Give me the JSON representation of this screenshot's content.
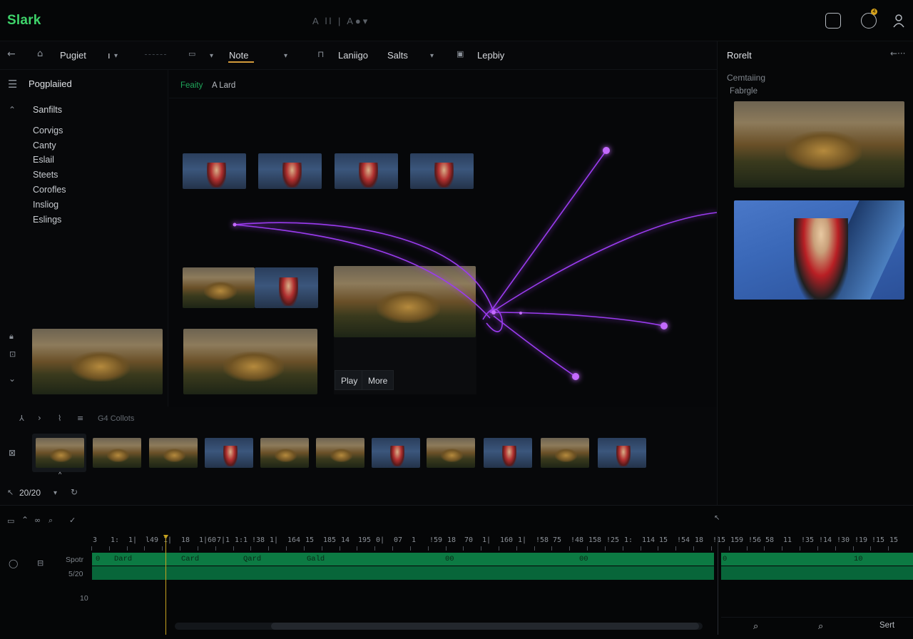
{
  "app": {
    "logo": "Slark",
    "center_title": "A ll | A●▾"
  },
  "topbar": {
    "icons": [
      "bag-icon",
      "notification-icon",
      "profile-icon"
    ],
    "badge": "4"
  },
  "toolbar": {
    "items": [
      {
        "label": "Pugiet"
      },
      {
        "label": "ı"
      },
      {
        "label": "Note"
      },
      {
        "label": "Laniigo"
      },
      {
        "label": "Salts"
      },
      {
        "label": "Lepbiy"
      }
    ]
  },
  "sidebar": {
    "title": "Pogplaiied",
    "section": "Sanfilts",
    "items": [
      "Corvigs",
      "Canty",
      "Eslail",
      "Steets",
      "Corofles",
      "Insliog",
      "Eslings"
    ]
  },
  "canvas": {
    "filters": [
      "Feaity",
      "A Lard"
    ],
    "buttons": {
      "play": "Play",
      "more": "More"
    }
  },
  "filmstrip": {
    "label": "G4 Collots",
    "counter": "20/20"
  },
  "right_panel": {
    "title": "Rorelt",
    "subtitle": "Cemtaiing",
    "label": "Fabrgle"
  },
  "timeline": {
    "ruler": [
      "3",
      "1:",
      "1|",
      "l49",
      "1|",
      "18",
      "1|60",
      "7|1",
      "1:1",
      "!38",
      "1|",
      "164",
      "15",
      "185",
      "14",
      "195",
      "0|",
      "07",
      "1",
      "!59",
      "18",
      "70",
      "1|",
      "160",
      "1|",
      "!58",
      "75",
      "!48",
      "158",
      "!25",
      "1:",
      "114",
      "15",
      "!54",
      "18",
      "!15",
      "159",
      "!56",
      "58",
      "11",
      "!35",
      "!14",
      "!30",
      "!19",
      "!15",
      "15"
    ],
    "track_labels": {
      "side_top": "Spotr",
      "side_mid": "5/20",
      "side_bot": "10"
    },
    "clips": [
      "0",
      "Dard",
      "Card",
      "Qard",
      "Gald",
      "00",
      "00",
      "0",
      "10"
    ],
    "bottom_buttons": {
      "search": "⌕",
      "search2": "⌕",
      "sort": "Sert"
    }
  }
}
